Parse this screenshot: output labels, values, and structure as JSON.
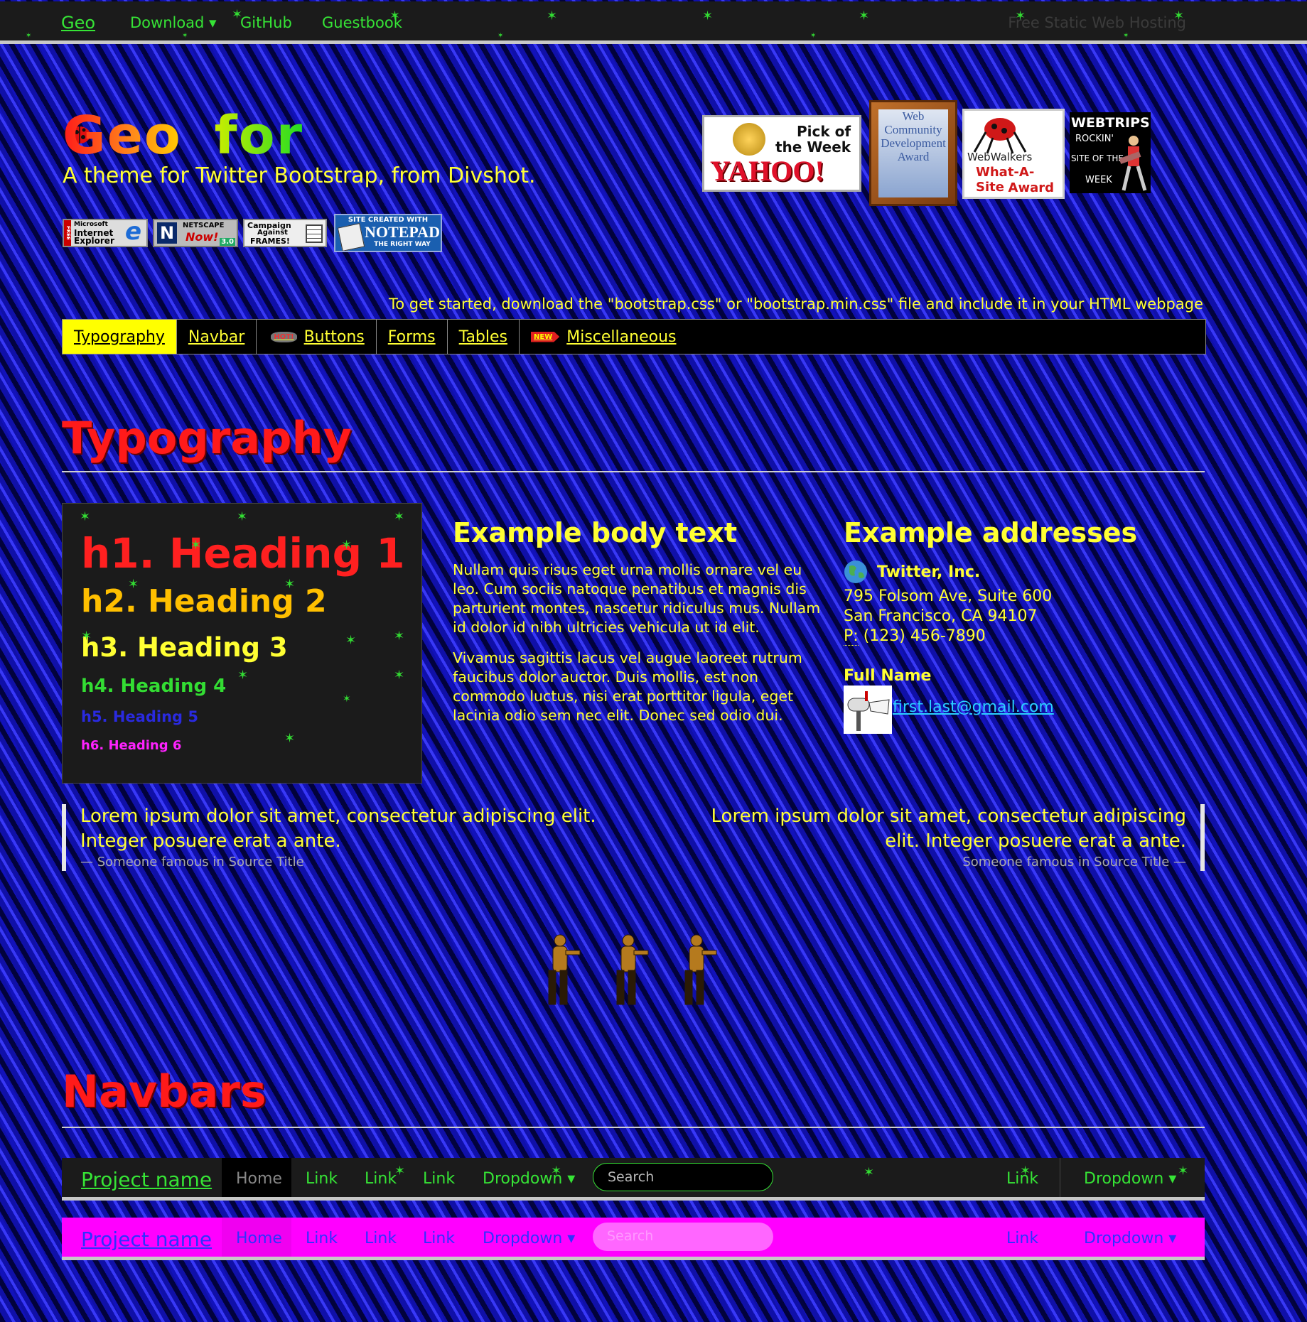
{
  "topnav": {
    "brand": "Geo",
    "items": [
      "Download ▾",
      "GitHub",
      "Guestbook"
    ],
    "right_link": "Free Static Web Hosting"
  },
  "header": {
    "title_word1": "Geo",
    "title_word2": "for",
    "subtitle": "A theme for Twitter Bootstrap, from Divshot.",
    "badges": [
      {
        "line1": "Microsoft",
        "line2": "Internet",
        "line3": "Explorer",
        "side": "FREE",
        "glyph": "e"
      },
      {
        "line1": "NETSCAPE",
        "line2": "Now!",
        "glyph": "N",
        "corner": "3.0"
      },
      {
        "line1": "Campaign",
        "line2": "Against",
        "line3": "FRAMES!"
      },
      {
        "line1": "SITE CREATED WITH",
        "line2": "NOTEPAD",
        "line3": "THE RIGHT WAY"
      }
    ],
    "awards": [
      {
        "line1": "Pick of",
        "line2": "the Week",
        "line3": "YAHOO!"
      },
      {
        "line1": "Web",
        "line2": "Community",
        "line3": "Development",
        "line4": "Award"
      },
      {
        "line1": "WebWalkers",
        "line2": "What-A-Site",
        "line3": "Award"
      },
      {
        "line1": "WEBTRIPS",
        "line2": "ROCKIN'",
        "line3": "SITE OF THE",
        "line4": "WEEK"
      }
    ],
    "get_started": "To get started, download the \"bootstrap.css\" or \"bootstrap.min.css\" file and include it in your HTML webpage"
  },
  "tabs": [
    {
      "label": "Typography",
      "active": true
    },
    {
      "label": "Navbar",
      "active": false
    },
    {
      "label": "Buttons",
      "active": false,
      "mini": "HOT!"
    },
    {
      "label": "Forms",
      "active": false
    },
    {
      "label": "Tables",
      "active": false
    },
    {
      "label": "Miscellaneous",
      "active": false,
      "mini": "NEW"
    }
  ],
  "typography": {
    "section_title": "Typography",
    "headings": [
      "h1. Heading 1",
      "h2. Heading 2",
      "h3. Heading 3",
      "h4. Heading 4",
      "h5. Heading 5",
      "h6. Heading 6"
    ],
    "heading_colors": [
      "#ff2020",
      "#ffbf00",
      "#ffff33",
      "#33dd33",
      "#2a2ae0",
      "#ff22ff"
    ],
    "body_title": "Example body text",
    "body_p1": "Nullam quis risus eget urna mollis ornare vel eu leo. Cum sociis natoque penatibus et magnis dis parturient montes, nascetur ridiculus mus. Nullam id dolor id nibh ultricies vehicula ut id elit.",
    "body_p2": "Vivamus sagittis lacus vel augue laoreet rutrum faucibus dolor auctor. Duis mollis, est non commodo luctus, nisi erat porttitor ligula, eget lacinia odio sem nec elit. Donec sed odio dui.",
    "addr_title": "Example addresses",
    "company": "Twitter, Inc.",
    "street": "795 Folsom Ave, Suite 600",
    "city": "San Francisco, CA 94107",
    "phone_label": "P:",
    "phone": "(123) 456-7890",
    "full_name": "Full Name",
    "email": "first.last@gmail.com",
    "quote_text": "Lorem ipsum dolor sit amet, consectetur adipiscing elit. Integer posuere erat a ante.",
    "quote_source_left": "— Someone famous in Source Title",
    "quote_source_right": "Someone famous in Source Title —"
  },
  "navbars": {
    "section_title": "Navbars",
    "brand": "Project name",
    "items": [
      "Home",
      "Link",
      "Link",
      "Link",
      "Dropdown ▾"
    ],
    "search_placeholder": "Search",
    "right_link": "Link",
    "right_dropdown": "Dropdown ▾"
  },
  "colors": {
    "background": "#1010a8",
    "accent_yellow": "#ffff33",
    "accent_green": "#36e436",
    "heading_red": "#ff1a1a",
    "navbar_dark": "#1b1b1b",
    "navbar_magenta": "#ff00ff"
  }
}
